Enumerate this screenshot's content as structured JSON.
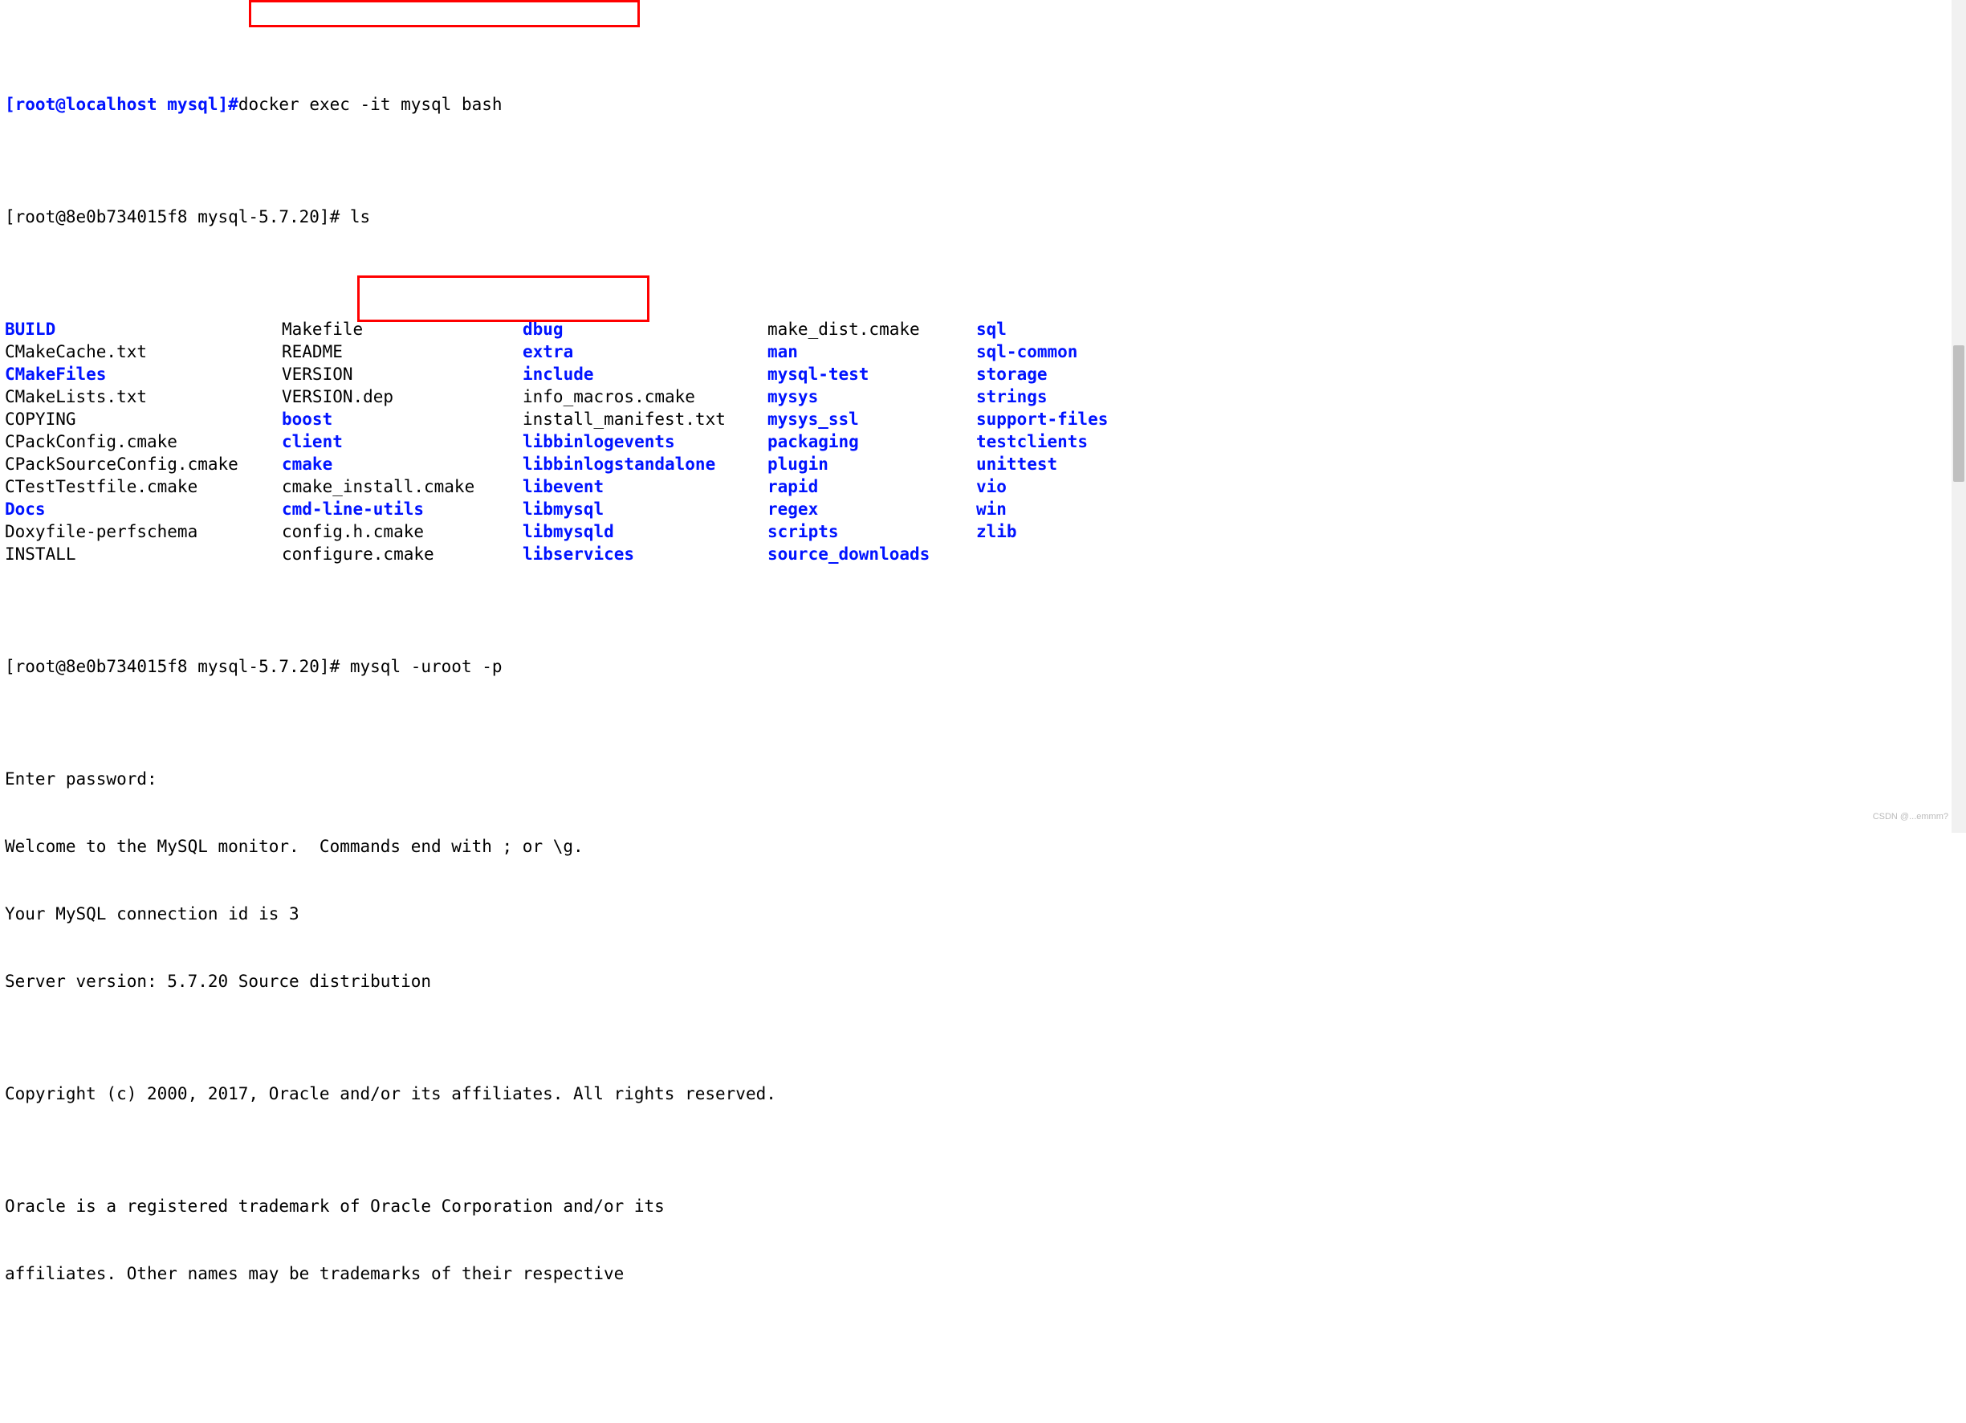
{
  "prompt1": {
    "prefix": "[root@localhost mysql]",
    "hash": "#",
    "cmd": "docker exec -it mysql bash"
  },
  "prompt2": {
    "text": "[root@8e0b734015f8 mysql-5.7.20]# ",
    "cmd": "ls"
  },
  "ls": {
    "rows": [
      [
        "BUILD",
        "Makefile",
        "dbug",
        "make_dist.cmake",
        "sql"
      ],
      [
        "CMakeCache.txt",
        "README",
        "extra",
        "man",
        "sql-common"
      ],
      [
        "CMakeFiles",
        "VERSION",
        "include",
        "mysql-test",
        "storage"
      ],
      [
        "CMakeLists.txt",
        "VERSION.dep",
        "info_macros.cmake",
        "mysys",
        "strings"
      ],
      [
        "COPYING",
        "boost",
        "install_manifest.txt",
        "mysys_ssl",
        "support-files"
      ],
      [
        "CPackConfig.cmake",
        "client",
        "libbinlogevents",
        "packaging",
        "testclients"
      ],
      [
        "CPackSourceConfig.cmake",
        "cmake",
        "libbinlogstandalone",
        "plugin",
        "unittest"
      ],
      [
        "CTestTestfile.cmake",
        "cmake_install.cmake",
        "libevent",
        "rapid",
        "vio"
      ],
      [
        "Docs",
        "cmd-line-utils",
        "libmysql",
        "regex",
        "win"
      ],
      [
        "Doxyfile-perfschema",
        "config.h.cmake",
        "libmysqld",
        "scripts",
        "zlib"
      ],
      [
        "INSTALL",
        "configure.cmake",
        "libservices",
        "source_downloads",
        ""
      ]
    ],
    "blueMap": {
      "0": [
        true,
        false,
        true,
        false,
        true
      ],
      "1": [
        false,
        false,
        true,
        true,
        true
      ],
      "2": [
        true,
        false,
        true,
        true,
        true
      ],
      "3": [
        false,
        false,
        false,
        true,
        true
      ],
      "4": [
        false,
        true,
        false,
        true,
        true
      ],
      "5": [
        false,
        true,
        true,
        true,
        true
      ],
      "6": [
        false,
        true,
        true,
        true,
        true
      ],
      "7": [
        false,
        false,
        true,
        true,
        true
      ],
      "8": [
        true,
        true,
        true,
        true,
        true
      ],
      "9": [
        false,
        false,
        true,
        true,
        true
      ],
      "10": [
        false,
        false,
        true,
        true,
        false
      ]
    }
  },
  "prompt3": {
    "text": "[root@8e0b734015f8 mysql-5.7.20]# ",
    "cmd": "mysql -uroot -p"
  },
  "out": {
    "l1": "Enter password:",
    "l2": "Welcome to the MySQL monitor.  Commands end with ; or \\g.",
    "l3": "Your MySQL connection id is 3",
    "l4": "Server version: 5.7.20 Source distribution",
    "l5": "",
    "l6": "Copyright (c) 2000, 2017, Oracle and/or its affiliates. All rights reserved.",
    "l7": "",
    "l8": "Oracle is a registered trademark of Oracle Corporation and/or its",
    "l9": "affiliates. Other names may be trademarks of their respective"
  },
  "watermark": "CSDN @...emmm?"
}
